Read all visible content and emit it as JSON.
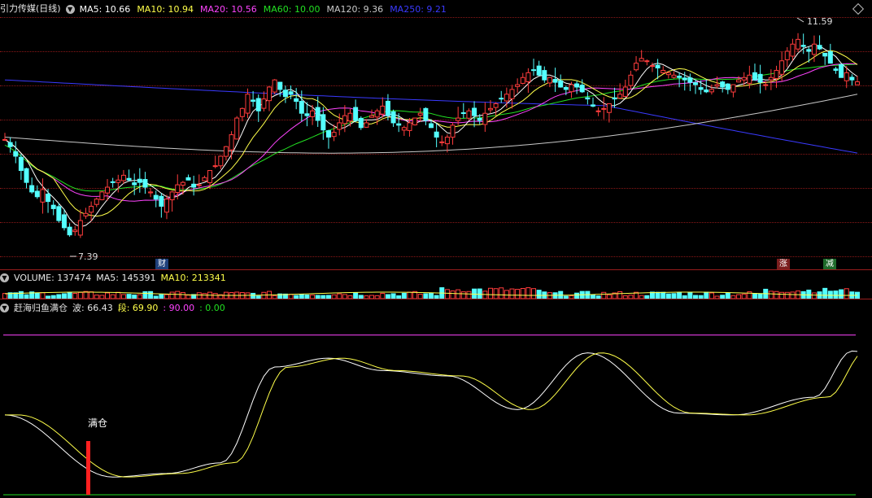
{
  "main": {
    "title": "引力传媒(日线)",
    "ma": [
      {
        "label": "MA5: 10.66",
        "color": "#ffffff"
      },
      {
        "label": "MA10: 10.94",
        "color": "#ffff4a"
      },
      {
        "label": "MA20: 10.56",
        "color": "#ff44ff"
      },
      {
        "label": "MA60: 10.00",
        "color": "#22e022"
      },
      {
        "label": "MA120: 9.36",
        "color": "#c8c8c8"
      },
      {
        "label": "MA250: 9.21",
        "color": "#3a3aff"
      }
    ],
    "high_label": "11.59",
    "low_label": "7.39",
    "badge_cai": "财",
    "badge_zhang": "涨",
    "badge_jian": "减"
  },
  "volume": {
    "label_vol": "VOLUME: 137474",
    "label_ma5": "MA5: 145391",
    "label_ma10": "MA10: 213341"
  },
  "indicator": {
    "name": "赶海归鱼满仓",
    "bo": "波: 66.43",
    "duan": "段: 69.90",
    "v90": ": 90.00",
    "v0": ": 0.00",
    "mark": "满仓"
  },
  "colors": {
    "up": "#ff3c3c",
    "down": "#54ffff",
    "grid": "#8a1818"
  },
  "chart_data": {
    "type": "candlestick",
    "price_range": [
      7.0,
      12.0
    ],
    "closes": [
      9.45,
      9.3,
      9.1,
      8.8,
      8.55,
      8.35,
      8.25,
      8.4,
      8.15,
      8.0,
      7.75,
      7.6,
      7.45,
      7.55,
      7.75,
      7.9,
      8.05,
      8.2,
      8.35,
      8.45,
      8.55,
      8.6,
      8.7,
      8.6,
      8.5,
      8.55,
      8.45,
      8.35,
      8.2,
      8.05,
      8.2,
      8.35,
      8.5,
      8.55,
      8.6,
      8.45,
      8.5,
      8.65,
      8.8,
      8.9,
      9.1,
      9.3,
      9.55,
      9.9,
      10.1,
      10.4,
      10.25,
      10.05,
      10.3,
      10.55,
      10.7,
      10.5,
      10.35,
      10.4,
      10.25,
      10.0,
      9.95,
      10.05,
      9.85,
      9.65,
      9.5,
      9.6,
      9.8,
      9.95,
      10.0,
      9.85,
      9.7,
      9.8,
      9.95,
      10.05,
      10.15,
      9.95,
      9.8,
      9.75,
      9.7,
      9.8,
      9.9,
      10.0,
      9.85,
      9.7,
      9.5,
      9.4,
      9.5,
      9.75,
      9.9,
      10.0,
      10.05,
      9.95,
      9.85,
      10.0,
      10.1,
      10.2,
      10.3,
      10.4,
      10.5,
      10.6,
      10.75,
      10.85,
      10.9,
      10.8,
      10.7,
      10.75,
      10.65,
      10.55,
      10.5,
      10.6,
      10.55,
      10.45,
      10.3,
      10.15,
      10.05,
      10.1,
      10.2,
      10.3,
      10.4,
      10.55,
      10.8,
      11.05,
      11.15,
      11.1,
      11.0,
      10.95,
      10.9,
      10.85,
      10.8,
      10.75,
      10.7,
      10.65,
      10.6,
      10.5,
      10.45,
      10.5,
      10.6,
      10.55,
      10.5,
      10.6,
      10.7,
      10.75,
      10.8,
      10.7,
      10.65,
      10.6,
      10.75,
      10.9,
      11.1,
      11.3,
      11.45,
      11.55,
      11.4,
      11.3,
      11.45,
      11.35,
      11.2,
      11.05,
      10.9,
      10.75,
      10.85,
      10.7,
      10.66
    ]
  }
}
